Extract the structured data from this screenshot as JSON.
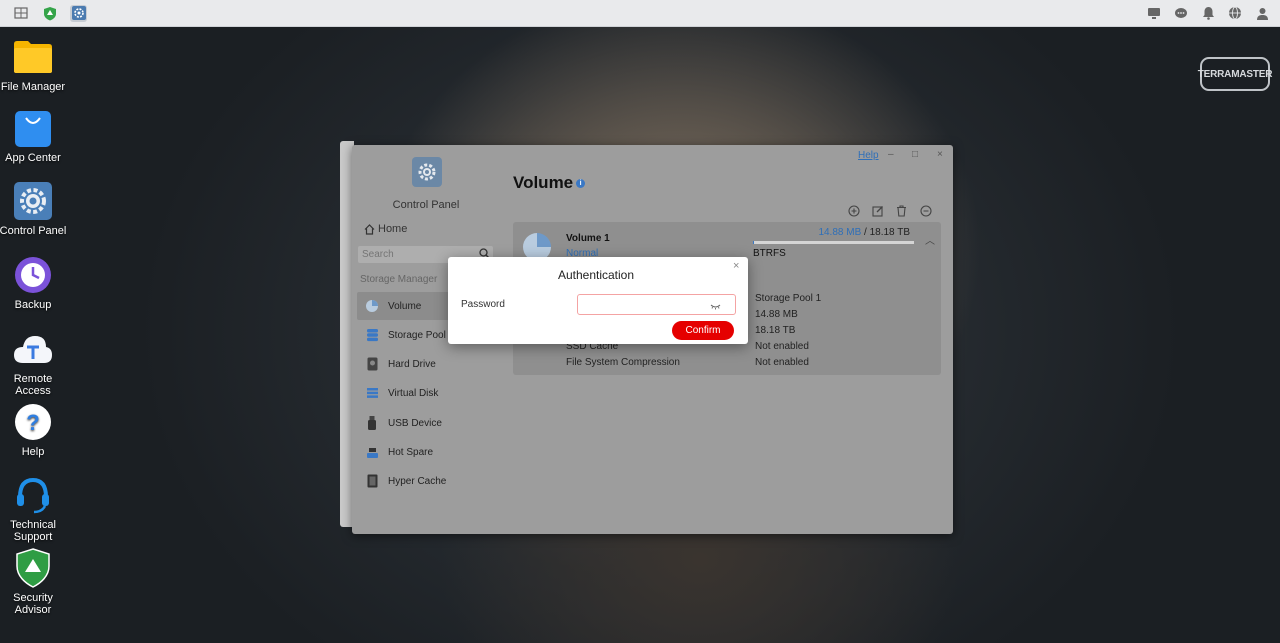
{
  "desktop": {
    "icons": [
      {
        "label": "File Manager",
        "icon": "folder-icon"
      },
      {
        "label": "App Center",
        "icon": "shopping-bag-icon"
      },
      {
        "label": "Control Panel",
        "icon": "gear-icon"
      },
      {
        "label": "Backup",
        "icon": "clock-icon"
      },
      {
        "label": "Remote Access",
        "icon": "cloud-icon"
      },
      {
        "label": "Help",
        "icon": "question-icon"
      },
      {
        "label": "Technical Support",
        "icon": "headset-icon"
      },
      {
        "label": "Security Advisor",
        "icon": "shield-icon"
      }
    ],
    "brand": "TERRAMASTER"
  },
  "control_panel": {
    "title": "Control Panel",
    "help_link": "Help",
    "home": "Home",
    "search_placeholder": "Search",
    "section": "Storage Manager",
    "nav": [
      {
        "label": "Volume",
        "icon": "pie-icon"
      },
      {
        "label": "Storage Pool",
        "icon": "database-icon"
      },
      {
        "label": "Hard Drive",
        "icon": "disk-icon"
      },
      {
        "label": "Virtual Disk",
        "icon": "virtual-disk-icon"
      },
      {
        "label": "USB Device",
        "icon": "usb-icon"
      },
      {
        "label": "Hot Spare",
        "icon": "hot-spare-icon"
      },
      {
        "label": "Hyper Cache",
        "icon": "cache-icon"
      }
    ],
    "page_title": "Volume",
    "volume": {
      "name": "Volume 1",
      "status": "Normal",
      "used": "14.88 MB",
      "separator": "/",
      "total": "18.18 TB",
      "usage_fraction": 0.0,
      "filesystem": "BTRFS",
      "details": [
        {
          "label": "",
          "value": "Storage Pool 1"
        },
        {
          "label": "",
          "value": "14.88 MB"
        },
        {
          "label": "",
          "value": "18.18 TB"
        },
        {
          "label": "SSD Cache",
          "value": "Not enabled"
        },
        {
          "label": "File System Compression",
          "value": "Not enabled"
        }
      ]
    }
  },
  "auth_dialog": {
    "title": "Authentication",
    "password_label": "Password",
    "password_value": "",
    "confirm": "Confirm"
  },
  "colors": {
    "accent": "#e50000",
    "link": "#2f6fb8"
  }
}
